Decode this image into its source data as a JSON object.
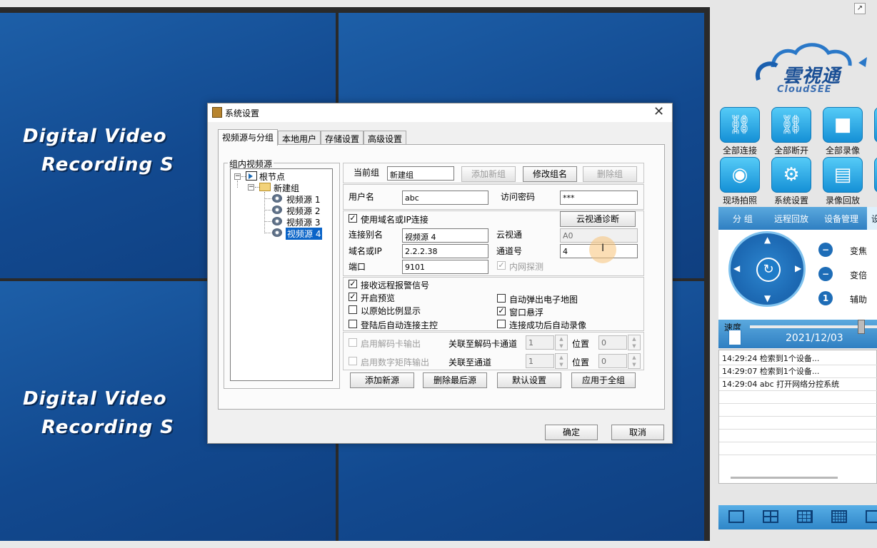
{
  "wall": {
    "line1": "Digital Video",
    "line2": "Recording S"
  },
  "right_panel": {
    "brand_cn": "雲視通",
    "brand_en": "CloudSEE",
    "tiles": [
      {
        "label": "全部连接",
        "icon": "link-icon"
      },
      {
        "label": "全部断开",
        "icon": "unlink-icon"
      },
      {
        "label": "全部录像",
        "icon": "record-icon"
      },
      {
        "label": "现场拍照",
        "icon": "camera-icon"
      },
      {
        "label": "系统设置",
        "icon": "gear-icon"
      },
      {
        "label": "录像回放",
        "icon": "clapper-icon"
      }
    ],
    "tabs": [
      "分 组",
      "远程回放",
      "设备管理",
      "设"
    ],
    "ptz": {
      "zoom": "变焦",
      "focus": "变倍",
      "aux": "辅助",
      "aux_num": "1"
    },
    "speed_label": "速度",
    "speed_level": 0.9,
    "date": "2021/12/03",
    "log": [
      "14:29:24 检索到1个设备...",
      "14:29:07 检索到1个设备...",
      "14:29:04 abc 打开网络分控系统"
    ]
  },
  "dialog": {
    "title": "系统设置",
    "tabs": [
      "视频源与分组",
      "本地用户",
      "存储设置",
      "高级设置"
    ],
    "group_legend": "组内视频源",
    "tree": {
      "root": "根节点",
      "group": "新建组",
      "items": [
        "视频源 1",
        "视频源 2",
        "视频源 3",
        "视频源 4"
      ],
      "selected_index": 3
    },
    "current_group_label": "当前组",
    "current_group": "新建组",
    "btn_add_group": "添加新组",
    "btn_rename_group": "修改组名",
    "btn_delete_group": "删除组",
    "username_label": "用户名",
    "username": "abc",
    "password_label": "访问密码",
    "password": "***",
    "use_domain_ip": "使用域名或IP连接",
    "btn_diag": "云视通诊断",
    "alias_label": "连接别名",
    "alias": "视频源 4",
    "cloudsee_label": "云视通",
    "cloudsee": "A0",
    "host_label": "域名或IP",
    "host": "2.2.2.38",
    "channel_label": "通道号",
    "channel": "4",
    "port_label": "端口",
    "port": "9101",
    "lan_probe": "内网探测",
    "opt_alarm": "接收远程报警信号",
    "opt_preview": "开启预览",
    "opt_emap": "自动弹出电子地图",
    "opt_ratio": "以原始比例显示",
    "opt_float": "窗口悬浮",
    "opt_master": "登陆后自动连接主控",
    "opt_autorec": "连接成功后自动录像",
    "decoder_out": "启用解码卡输出",
    "decoder_ch_label": "关联至解码卡通道",
    "decoder_ch": "1",
    "pos_label": "位置",
    "decoder_pos": "0",
    "matrix_out": "启用数字矩阵输出",
    "matrix_ch_label": "关联至通道",
    "matrix_ch": "1",
    "matrix_pos": "0",
    "btn_add_source": "添加新源",
    "btn_delete_last": "删除最后源",
    "btn_default": "默认设置",
    "btn_apply_all": "应用于全组",
    "btn_ok": "确定",
    "btn_cancel": "取消"
  }
}
